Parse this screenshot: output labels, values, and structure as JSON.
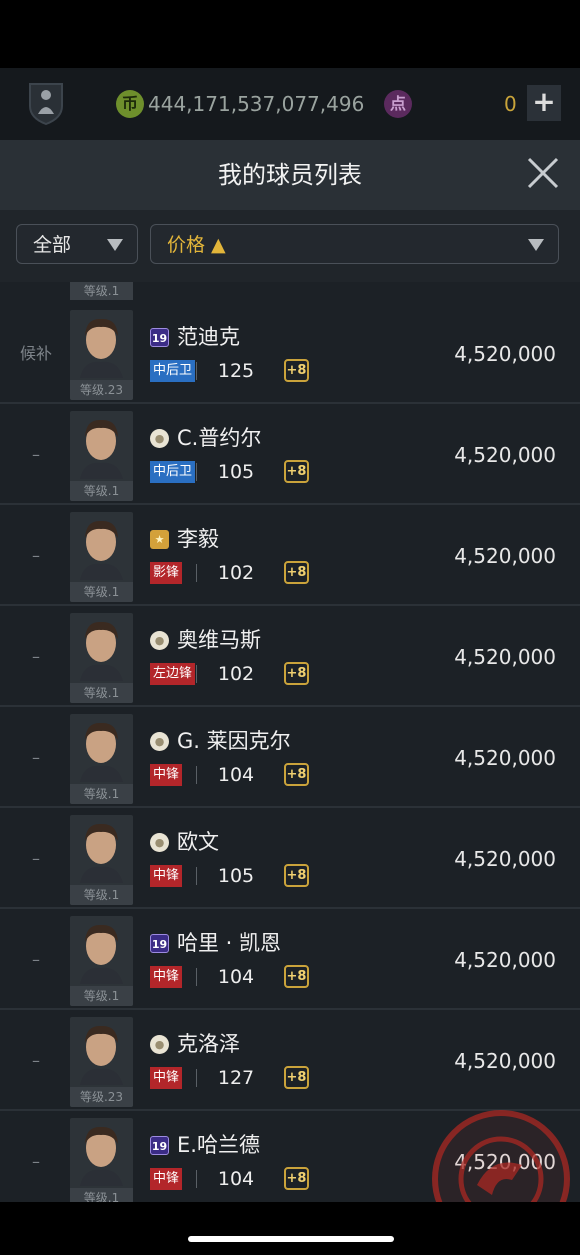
{
  "currency": {
    "coins": "444,171,537,077,496",
    "coin_icon": "币",
    "point_icon": "点",
    "points": "0",
    "add_label": "+"
  },
  "header": {
    "title": "我的球员列表"
  },
  "filters": {
    "category": "全部",
    "sort": "价格 ▲"
  },
  "list": {
    "partial_top_level": "等级.1",
    "rows": [
      {
        "status": "候补",
        "season": "19",
        "name": "范迪克",
        "position": "中后卫",
        "pos_type": "def",
        "ovr": "125",
        "upgrade": "+8",
        "level": "等级.23",
        "price": "4,520,000"
      },
      {
        "status": "–",
        "season": "base",
        "name": "C.普约尔",
        "position": "中后卫",
        "pos_type": "def",
        "ovr": "105",
        "upgrade": "+8",
        "level": "等级.1",
        "price": "4,520,000"
      },
      {
        "status": "–",
        "season": "star",
        "name": "李毅",
        "position": "影锋",
        "pos_type": "att",
        "ovr": "102",
        "upgrade": "+8",
        "level": "等级.1",
        "price": "4,520,000"
      },
      {
        "status": "–",
        "season": "base",
        "name": "奥维马斯",
        "position": "左边锋",
        "pos_type": "att",
        "ovr": "102",
        "upgrade": "+8",
        "level": "等级.1",
        "price": "4,520,000"
      },
      {
        "status": "–",
        "season": "base",
        "name": "G. 莱因克尔",
        "position": "中锋",
        "pos_type": "att",
        "ovr": "104",
        "upgrade": "+8",
        "level": "等级.1",
        "price": "4,520,000"
      },
      {
        "status": "–",
        "season": "base",
        "name": "欧文",
        "position": "中锋",
        "pos_type": "att",
        "ovr": "105",
        "upgrade": "+8",
        "level": "等级.1",
        "price": "4,520,000"
      },
      {
        "status": "–",
        "season": "19",
        "name": "哈里 · 凯恩",
        "position": "中锋",
        "pos_type": "att",
        "ovr": "104",
        "upgrade": "+8",
        "level": "等级.1",
        "price": "4,520,000"
      },
      {
        "status": "–",
        "season": "base",
        "name": "克洛泽",
        "position": "中锋",
        "pos_type": "att",
        "ovr": "127",
        "upgrade": "+8",
        "level": "等级.23",
        "price": "4,520,000"
      },
      {
        "status": "–",
        "season": "19",
        "name": "E.哈兰德",
        "position": "中锋",
        "pos_type": "att",
        "ovr": "104",
        "upgrade": "+8",
        "level": "等级.1",
        "price": "4,520,000"
      }
    ]
  }
}
